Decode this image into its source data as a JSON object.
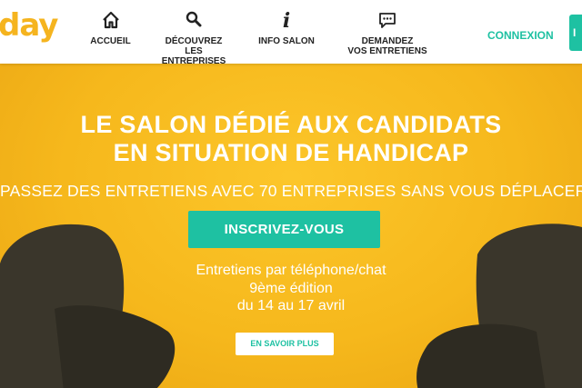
{
  "header": {
    "logo_text": "day",
    "nav": [
      {
        "icon": "home-icon",
        "label_line1": "ACCUEIL",
        "label_line2": ""
      },
      {
        "icon": "search-icon",
        "label_line1": "DÉCOUVREZ",
        "label_line2": "LES ENTREPRISES"
      },
      {
        "icon": "info-icon",
        "icon_glyph": "i",
        "label_line1": "INFO SALON",
        "label_line2": ""
      },
      {
        "icon": "chat-icon",
        "label_line1": "DEMANDEZ",
        "label_line2": "VOS ENTRETIENS"
      }
    ],
    "login_label": "CONNEXION",
    "cta_partial": "I"
  },
  "hero": {
    "title_line1": "LE SALON DÉDIÉ AUX CANDIDATS",
    "title_line2": "EN SITUATION DE HANDICAP",
    "subtitle": "PASSEZ DES ENTRETIENS AVEC 70 ENTREPRISES SANS VOUS DÉPLACER",
    "signup_label": "INSCRIVEZ-VOUS",
    "detail_line1": "Entretiens par téléphone/chat",
    "detail_line2": "9ème édition",
    "detail_line3": "du 14 au 17 avril",
    "more_label": "EN SAVOIR PLUS"
  },
  "colors": {
    "accent": "#1ec1a2",
    "background": "#f4b61a",
    "logo": "#f5b41f"
  }
}
